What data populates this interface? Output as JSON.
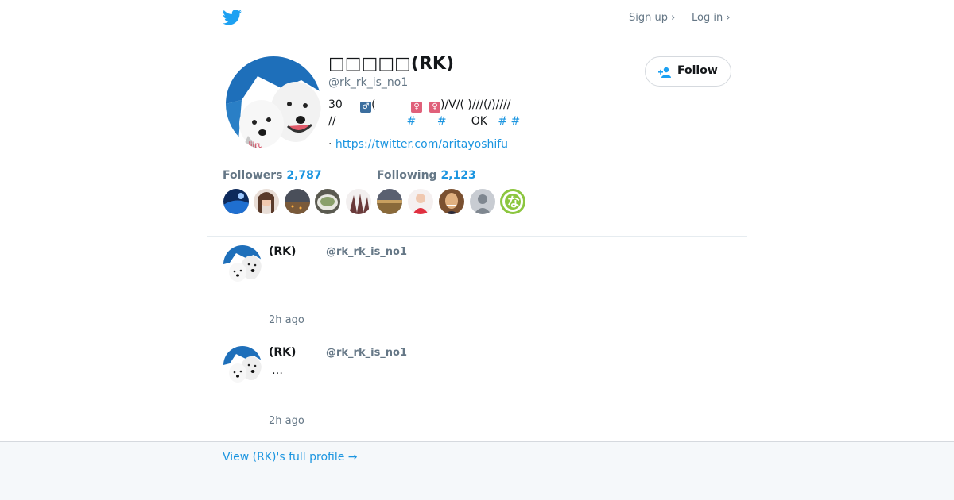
{
  "header": {
    "logo_icon": "twitter-bird-icon",
    "signup": "Sign up ›",
    "login": "Log in ›",
    "accent": "#1da1f2"
  },
  "profile": {
    "display_name": "□□□□□(RK)",
    "handle": "@rk_rk_is_no1",
    "bio_line1_a": "30",
    "bio_line1_b": "(",
    "bio_line1_c": ")/V/( )///(/)////",
    "bio_line2_a": "//",
    "bio_line2_ok": "OK",
    "bio_hash": "#",
    "url_prefix": "·",
    "url": "https://twitter.com/aritayoshifu",
    "follow_label": "Follow",
    "followers_label": "Followers",
    "followers_count": "2,787",
    "following_label": "Following",
    "following_count": "2,123"
  },
  "tweets": [
    {
      "name": "(RK)",
      "handle": "@rk_rk_is_no1",
      "text": "",
      "time": "2h ago"
    },
    {
      "name": "(RK)",
      "handle": "@rk_rk_is_no1",
      "text": "…",
      "time": "2h ago"
    }
  ],
  "footer": {
    "link": "View (RK)'s full profile →"
  },
  "colors": {
    "link": "#1b95e0",
    "muted": "#657786",
    "footer_bg": "#f5f8fa"
  }
}
